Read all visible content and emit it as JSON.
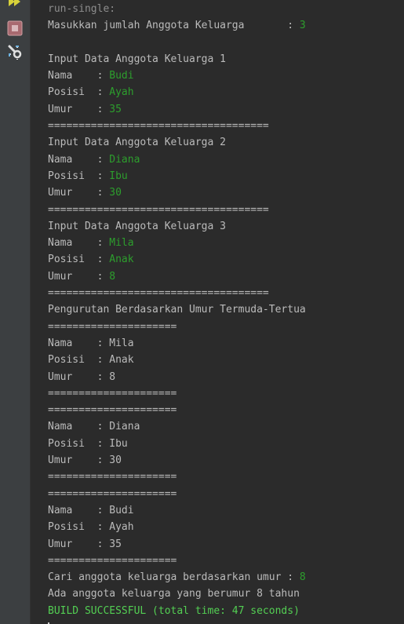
{
  "toolbar": {
    "icons": [
      "run-again-icon",
      "stop-icon",
      "settings-icon"
    ]
  },
  "colors": {
    "background": "#2b2b2b",
    "gutter": "#3c3f41",
    "text": "#bbbbbb",
    "user_input": "#2d9e2d",
    "build_success": "#53cf53"
  },
  "console": {
    "header": "run-single:",
    "prompt_count": {
      "label": "Masukkan jumlah Anggota Keluarga       : ",
      "value": "3"
    },
    "inputs": [
      {
        "title": "Input Data Anggota Keluarga 1",
        "nama_label": "Nama    : ",
        "nama": "Budi",
        "posisi_label": "Posisi  : ",
        "posisi": "Ayah",
        "umur_label": "Umur    : ",
        "umur": "35",
        "separator": "===================================="
      },
      {
        "title": "Input Data Anggota Keluarga 2",
        "nama_label": "Nama    : ",
        "nama": "Diana",
        "posisi_label": "Posisi  : ",
        "posisi": "Ibu",
        "umur_label": "Umur    : ",
        "umur": "30",
        "separator": "===================================="
      },
      {
        "title": "Input Data Anggota Keluarga 3",
        "nama_label": "Nama    : ",
        "nama": "Mila",
        "posisi_label": "Posisi  : ",
        "posisi": "Anak",
        "umur_label": "Umur    : ",
        "umur": "8",
        "separator": "===================================="
      }
    ],
    "sort_title": "Pengurutan Berdasarkan Umur Termuda-Tertua",
    "sorted_rows": [
      "=====================",
      "Nama    : Mila",
      "Posisi  : Anak",
      "Umur    : 8",
      "=====================",
      "=====================",
      "Nama    : Diana",
      "Posisi  : Ibu",
      "Umur    : 30",
      "=====================",
      "=====================",
      "Nama    : Budi",
      "Posisi  : Ayah",
      "Umur    : 35",
      "====================="
    ],
    "search_prompt": {
      "label": "Cari anggota keluarga berdasarkan umur : ",
      "value": "8"
    },
    "result": "Ada anggota keluarga yang berumur 8 tahun",
    "build": "BUILD SUCCESSFUL (total time: 47 seconds)"
  }
}
